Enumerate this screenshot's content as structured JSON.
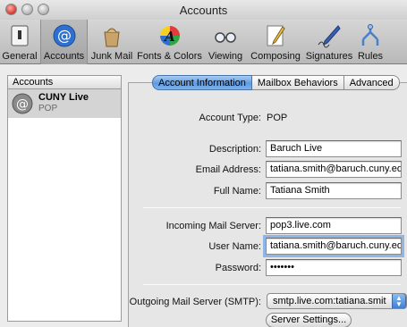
{
  "window": {
    "title": "Accounts"
  },
  "toolbar": {
    "items": [
      {
        "label": "General",
        "icon": "switch-icon"
      },
      {
        "label": "Accounts",
        "icon": "at-sign-icon"
      },
      {
        "label": "Junk Mail",
        "icon": "trash-bag-icon"
      },
      {
        "label": "Fonts & Colors",
        "icon": "fonts-colors-icon"
      },
      {
        "label": "Viewing",
        "icon": "glasses-icon"
      },
      {
        "label": "Composing",
        "icon": "pencil-paper-icon"
      },
      {
        "label": "Signatures",
        "icon": "signature-pen-icon"
      },
      {
        "label": "Rules",
        "icon": "rules-icon"
      }
    ],
    "selected": "Accounts"
  },
  "sidebar": {
    "header": "Accounts",
    "accounts": [
      {
        "name": "CUNY Live",
        "type": "POP"
      }
    ]
  },
  "tabs": [
    "Account Information",
    "Mailbox Behaviors",
    "Advanced"
  ],
  "form": {
    "account_type_label": "Account Type:",
    "account_type_value": "POP",
    "description_label": "Description:",
    "description_value": "Baruch Live",
    "email_label": "Email Address:",
    "email_value": "tatiana.smith@baruch.cuny.edu",
    "fullname_label": "Full Name:",
    "fullname_value": "Tatiana Smith",
    "incoming_label": "Incoming Mail Server:",
    "incoming_value": "pop3.live.com",
    "username_label": "User Name:",
    "username_value": "tatiana.smith@baruch.cuny.edu",
    "password_label": "Password:",
    "password_value": "•••••••",
    "smtp_label": "Outgoing Mail Server (SMTP):",
    "smtp_value": "smtp.live.com:tatiana.smit",
    "server_settings_button": "Server Settings..."
  },
  "colors": {
    "tab_active": "#5f9ae0",
    "focus_ring": "#8fb6e6"
  }
}
